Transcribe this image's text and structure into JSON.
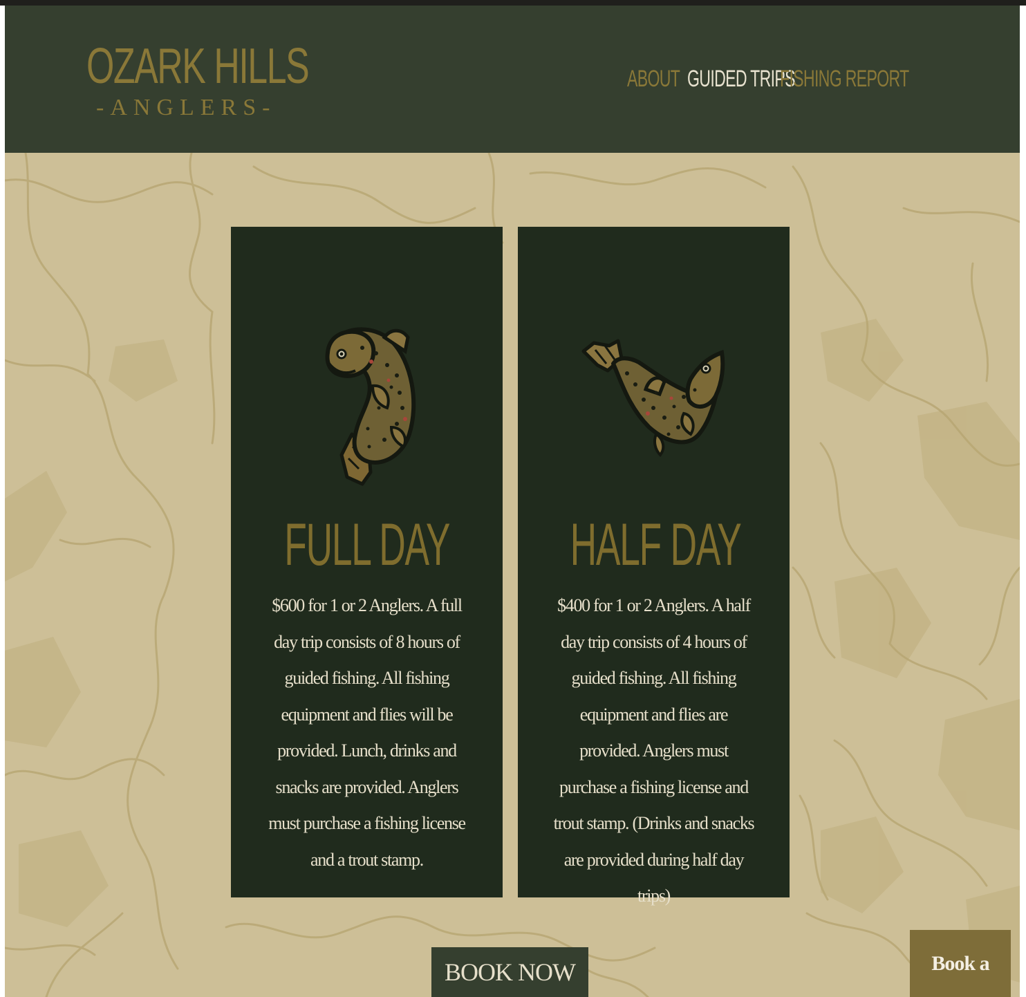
{
  "header": {
    "logo": {
      "title": "OZARK HILLS",
      "subtitle": "-ANGLERS-"
    },
    "nav": [
      {
        "label": "ABOUT",
        "active": false
      },
      {
        "label": "GUIDED TRIPS",
        "active": true
      },
      {
        "label": "FISHING REPORT",
        "active": false
      }
    ]
  },
  "cards": [
    {
      "title": "FULL DAY",
      "icon": "trout-jumping-icon",
      "description": "$600 for 1 or 2 Anglers. A full day trip consists of 8 hours of guided fishing. All fishing equipment and flies will be provided. Lunch, drinks and snacks are provided. Anglers must purchase a fishing license and a trout stamp."
    },
    {
      "title": "HALF DAY",
      "icon": "trout-leaping-icon",
      "description": "$400 for 1 or 2 Anglers. A half day trip consists of 4 hours of guided fishing. All fishing equipment and flies are provided. Anglers must purchase a fishing license and trout stamp. (Drinks and snacks are provided during half day trips)"
    }
  ],
  "actions": {
    "book_now": "BOOK NOW",
    "book_trip": "Book a Trip!"
  },
  "colors": {
    "header_bg": "#353f2f",
    "page_bg": "#cdbf97",
    "card_bg": "#202b1d",
    "gold": "#8a7838",
    "cream": "#e6dfca",
    "book_trip_bg": "#7e6d39"
  }
}
